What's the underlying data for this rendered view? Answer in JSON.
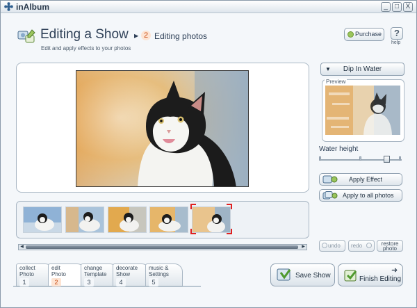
{
  "window": {
    "title": "inAlbum",
    "controls": [
      "_",
      "□",
      "X"
    ]
  },
  "header": {
    "title": "Editing a Show",
    "step_number": "2",
    "step_label": "Editing photos",
    "subtitle": "Edit and apply effects to your photos",
    "purchase_label": "Purchase",
    "help_symbol": "?",
    "help_label": "help"
  },
  "effect_panel": {
    "selected_effect": "Dip In Water",
    "preview_label": "Preview",
    "parameter_label": "Water height",
    "parameter_value_fraction": 0.82,
    "apply_effect_label": "Apply Effect",
    "apply_all_label": "Apply to all photos"
  },
  "history": {
    "undo_label": "undo",
    "redo_label": "redo",
    "restore_label": [
      "restore",
      "photo"
    ]
  },
  "filmstrip": {
    "selected_index": 4,
    "photo_count": 5
  },
  "steps": [
    {
      "label_line1": "collect",
      "label_line2": "Photo",
      "number": "1",
      "active": false
    },
    {
      "label_line1": "edit",
      "label_line2": "Photo",
      "number": "2",
      "active": true
    },
    {
      "label_line1": "change",
      "label_line2": "Template",
      "number": "3",
      "active": false
    },
    {
      "label_line1": "decorate",
      "label_line2": "Show",
      "number": "4",
      "active": false
    },
    {
      "label_line1": "music &",
      "label_line2": "Settings",
      "number": "5",
      "active": false
    }
  ],
  "footer": {
    "save_label": "Save Show",
    "finish_label": "Finish Editing"
  },
  "colors": {
    "accent_orange": "#c84a10",
    "accent_green": "#4f9a2e",
    "frame_border": "#a9b7c4"
  },
  "icons": [
    "app-logo-icon",
    "edit-photos-icon",
    "cart-icon",
    "help-icon",
    "dropdown-caret-icon",
    "apply-effect-icon",
    "apply-all-icon",
    "undo-icon",
    "redo-icon",
    "save-show-icon",
    "finish-editing-icon"
  ]
}
